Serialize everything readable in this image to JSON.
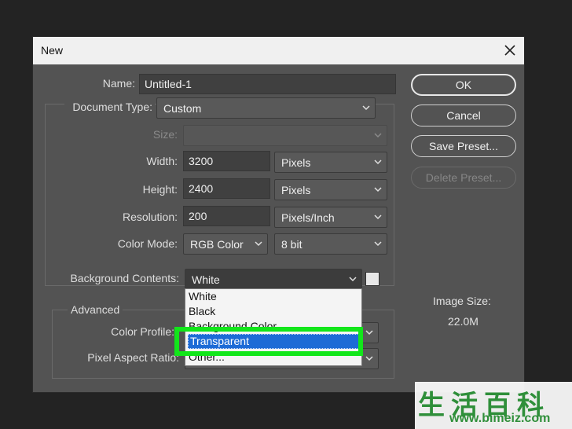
{
  "window": {
    "title": "New",
    "close_icon": "close-icon"
  },
  "form": {
    "name_label": "Name:",
    "name_value": "Untitled-1",
    "document_type_label": "Document Type:",
    "document_type_value": "Custom",
    "size_label": "Size:",
    "size_value": "",
    "width_label": "Width:",
    "width_value": "3200",
    "width_unit": "Pixels",
    "height_label": "Height:",
    "height_value": "2400",
    "height_unit": "Pixels",
    "resolution_label": "Resolution:",
    "resolution_value": "200",
    "resolution_unit": "Pixels/Inch",
    "color_mode_label": "Color Mode:",
    "color_mode_value": "RGB Color",
    "bit_depth_value": "8 bit",
    "background_label": "Background Contents:",
    "background_value": "White",
    "advanced_label": "Advanced",
    "color_profile_label": "Color Profile:",
    "pixel_aspect_label": "Pixel Aspect Ratio:"
  },
  "dropdown": {
    "options": [
      "White",
      "Black",
      "Background Color",
      "Transparent",
      "Other..."
    ],
    "selected": "Transparent",
    "highlight_color": "#12e61a"
  },
  "buttons": {
    "ok": "OK",
    "cancel": "Cancel",
    "save_preset": "Save Preset...",
    "delete_preset": "Delete Preset..."
  },
  "image_size": {
    "label": "Image Size:",
    "value": "22.0M"
  },
  "watermark": {
    "characters": "生活百科",
    "url": "www.bimeiz.com"
  }
}
